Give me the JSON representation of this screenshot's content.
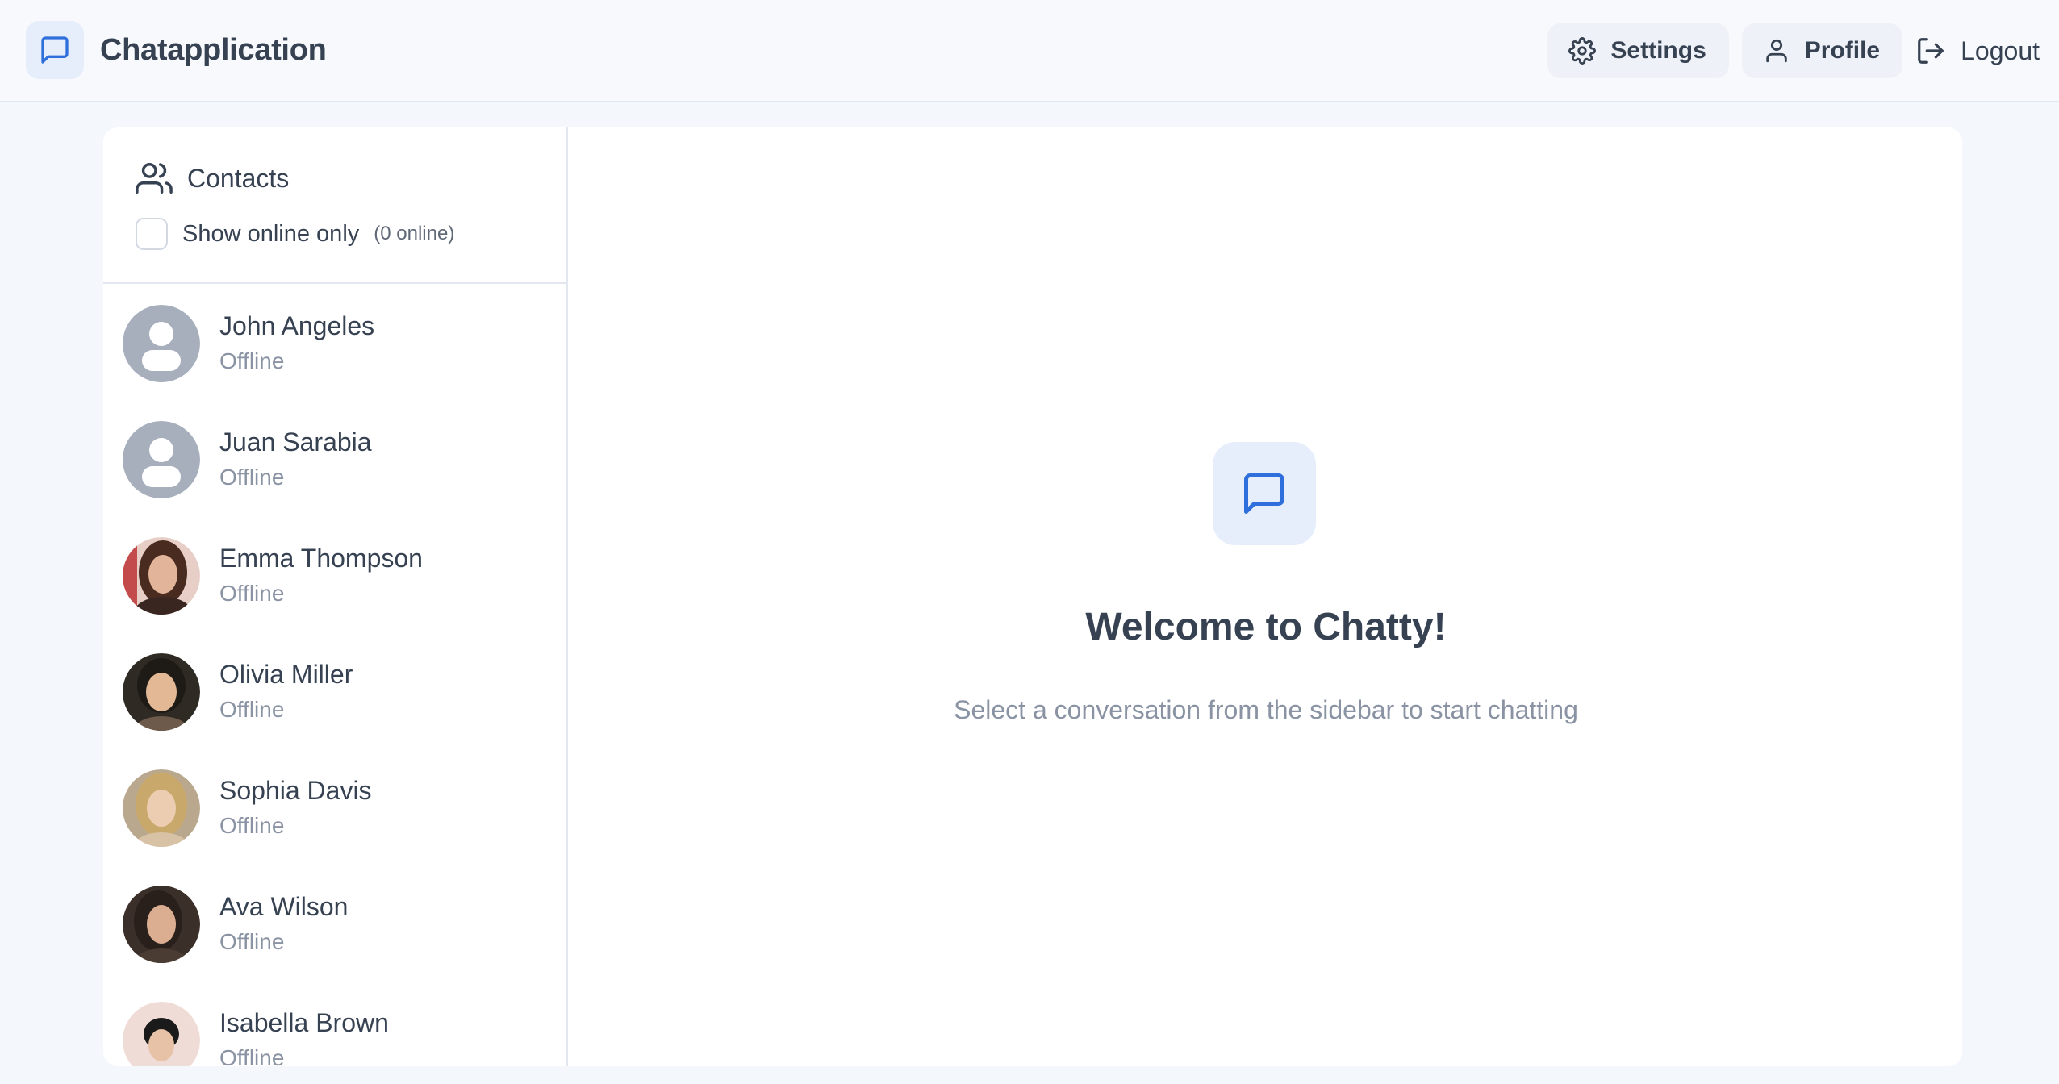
{
  "app": {
    "brand_name": "Chatapplication",
    "brand_icon": "message-square-icon"
  },
  "nav": {
    "settings_label": "Settings",
    "settings_icon": "gear-icon",
    "profile_label": "Profile",
    "profile_icon": "user-icon",
    "logout_label": "Logout",
    "logout_icon": "logout-icon"
  },
  "sidebar": {
    "title": "Contacts",
    "title_icon": "users-icon",
    "online_filter_label": "Show online only",
    "online_filter_checked": false,
    "online_count": "(0 online)",
    "contacts": [
      {
        "name": "John Angeles",
        "status": "Offline",
        "avatar": "default-avatar"
      },
      {
        "name": "Juan Sarabia",
        "status": "Offline",
        "avatar": "default-avatar"
      },
      {
        "name": "Emma Thompson",
        "status": "Offline",
        "avatar": "photo-avatar"
      },
      {
        "name": "Olivia Miller",
        "status": "Offline",
        "avatar": "photo-avatar"
      },
      {
        "name": "Sophia Davis",
        "status": "Offline",
        "avatar": "photo-avatar"
      },
      {
        "name": "Ava Wilson",
        "status": "Offline",
        "avatar": "photo-avatar"
      },
      {
        "name": "Isabella Brown",
        "status": "Offline",
        "avatar": "photo-avatar"
      }
    ]
  },
  "main": {
    "welcome_icon": "message-square-icon",
    "welcome_title": "Welcome to Chatty!",
    "welcome_subtitle": "Select a conversation from the sidebar to start chatting"
  },
  "colors": {
    "accent": "#2f6fdb",
    "accent_soft": "#e6eefb",
    "text": "#364152",
    "muted": "#8a93a3",
    "background": "#f4f7fc"
  }
}
